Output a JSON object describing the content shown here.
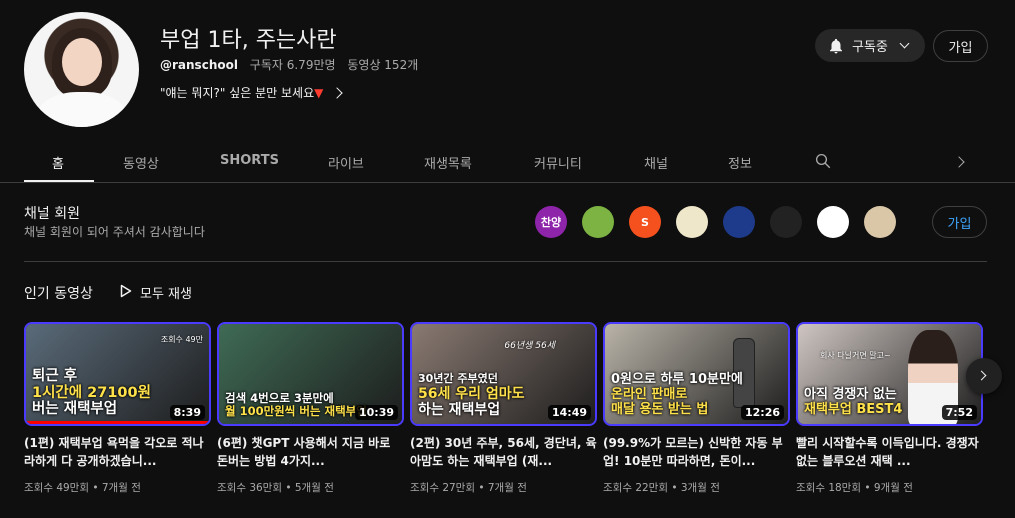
{
  "channel": {
    "name": "부업 1타, 주는사란",
    "handle": "@ranschool",
    "subscribers": "구독자 6.79만명",
    "videos": "동영상 152개",
    "description": "\"얘는 뭐지?\" 싶은 분만 보세요",
    "description_marker": "▼",
    "subscribe_label": "구독중",
    "join_label": "가입"
  },
  "tabs": [
    {
      "label": "홈",
      "active": true
    },
    {
      "label": "동영상"
    },
    {
      "label": "SHORTS"
    },
    {
      "label": "라이브"
    },
    {
      "label": "재생목록"
    },
    {
      "label": "커뮤니티"
    },
    {
      "label": "채널"
    },
    {
      "label": "정보"
    }
  ],
  "membership": {
    "title": "채널 회원",
    "subtitle": "채널 회원이 되어 주셔서 감사합니다",
    "join_label": "가입",
    "badges": [
      {
        "text": "찬양",
        "color": "#8e24aa"
      },
      {
        "text": "",
        "color": "#7cb342"
      },
      {
        "text": "S",
        "color": "#f4511e"
      },
      {
        "text": "",
        "color": "#efe7c9"
      },
      {
        "text": "",
        "color": "#1e3a8a"
      },
      {
        "text": "",
        "color": "#222222"
      },
      {
        "text": "",
        "color": "#ffffff"
      },
      {
        "text": "",
        "color": "#d9c7a8"
      }
    ]
  },
  "popular": {
    "title": "인기 동영상",
    "play_all": "모두 재생",
    "videos": [
      {
        "caption_lines": [
          "퇴근 후",
          "1시간에 27100원",
          "버는 재택부업"
        ],
        "highlight": [
          false,
          true,
          false
        ],
        "duration": "8:39",
        "title": "(1편) 재택부업 욕먹을 각오로 적나라하게 다 공개하겠습니...",
        "meta": "조회수 49만회 • 7개월 전",
        "bg": "#5a6b7a"
      },
      {
        "caption_lines": [
          "검색 4번으로 3분만에",
          "월 100만원씩 버는 재택부업"
        ],
        "highlight": [
          false,
          true
        ],
        "duration": "10:39",
        "title": "(6편) 챗GPT 사용해서 지금 바로 돈버는 방법 4가지...",
        "meta": "조회수 36만회 • 5개월 전",
        "bg": "#3f6b55"
      },
      {
        "caption_lines": [
          "30년간 주부였던",
          "56세 우리 엄마도",
          "하는 재택부업"
        ],
        "highlight": [
          false,
          true,
          false
        ],
        "duration": "14:49",
        "title": "(2편) 30년 주부, 56세, 경단녀, 육아맘도 하는 재택부업 (재...",
        "meta": "조회수 27만회 • 7개월 전",
        "bg": "#8a7a72"
      },
      {
        "caption_lines": [
          "0원으로 하루 10분만에",
          "온라인 판매로",
          "매달 용돈 받는 법"
        ],
        "highlight": [
          false,
          true,
          false
        ],
        "duration": "12:26",
        "title": "(99.9%가 모르는) 신박한 자동 부업! 10분만 따라하면, 돈이...",
        "meta": "조회수 22만회 • 3개월 전",
        "bg": "#b9b3a8"
      },
      {
        "caption_lines": [
          "아직 경쟁자 없는",
          "재택부업 BEST4"
        ],
        "highlight": [
          false,
          true
        ],
        "duration": "7:52",
        "title": "빨리 시작할수록 이득입니다. 경쟁자 없는 블루오션 재택 ...",
        "meta": "조회수 18만회 • 9개월 전",
        "bg": "#cfc6c2"
      }
    ]
  },
  "thumb_tags": [
    "조회수 49만",
    "66년생 56세",
    "회사 다닐거면 말고~"
  ]
}
